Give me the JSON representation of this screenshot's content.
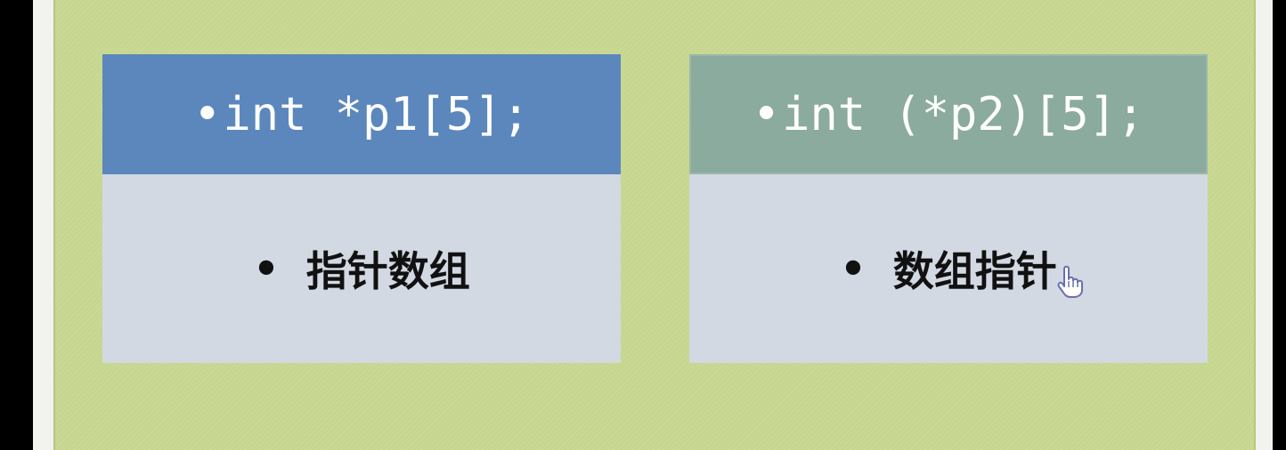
{
  "slide": {
    "left_box": {
      "bullet": "•",
      "code": "int *p1[5];",
      "item_bullet": "•",
      "item": "指针数组",
      "header_color": "#5b87bc",
      "body_color": "#d2d9e3"
    },
    "right_box": {
      "bullet": "•",
      "code": "int (*p2)[5];",
      "item_bullet": "•",
      "item": "数组指针",
      "header_color": "#8aab9e",
      "body_color": "#d2d9e3"
    },
    "background_color": "#c7d68f"
  },
  "cursor": {
    "icon": "hand-pointer-icon"
  }
}
